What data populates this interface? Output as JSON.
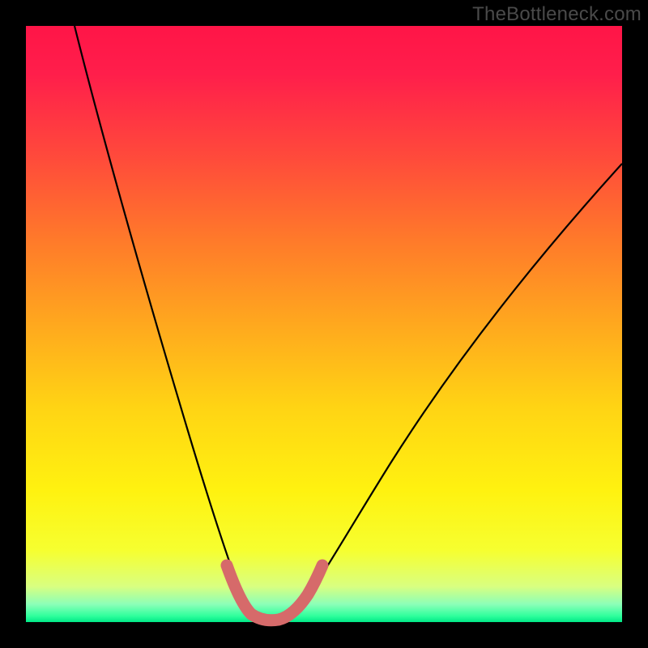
{
  "watermark": "TheBottleneck.com",
  "colors": {
    "page_bg": "#000000",
    "curve_stroke": "#000000",
    "highlight_stroke": "#d66a6a",
    "gradient_top": "#ff1547",
    "gradient_bottom": "#00e886"
  },
  "chart_data": {
    "type": "line",
    "title": "",
    "xlabel": "",
    "ylabel": "",
    "xlim": [
      0,
      100
    ],
    "ylim": [
      0,
      100
    ],
    "series": [
      {
        "name": "bottleneck-curve",
        "x": [
          0,
          5,
          10,
          15,
          20,
          25,
          28,
          30,
          32,
          34,
          36,
          38,
          40,
          42,
          44,
          50,
          55,
          60,
          65,
          70,
          75,
          80,
          85,
          90,
          95,
          100
        ],
        "y": [
          100,
          90,
          78,
          64,
          48,
          30,
          16,
          8,
          3,
          1,
          0,
          0,
          1,
          3,
          6,
          14,
          22,
          30,
          38,
          45,
          52,
          58,
          64,
          69,
          74,
          78
        ]
      }
    ],
    "highlight_range_x": [
      30,
      44
    ],
    "note": "Values estimated from pixel positions; axis is unlabeled so 0–100 normalized."
  }
}
